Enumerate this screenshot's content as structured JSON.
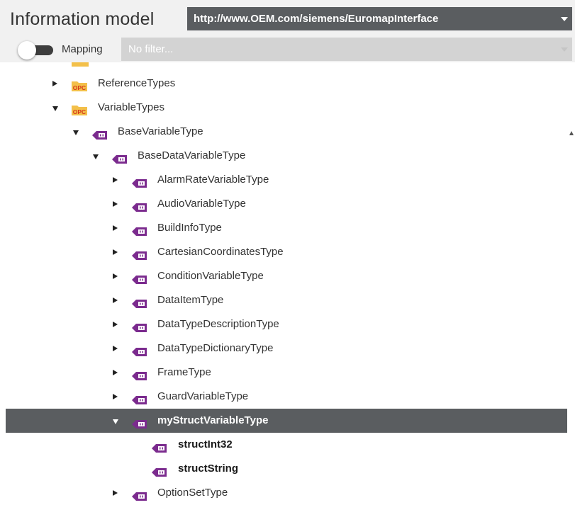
{
  "header": {
    "title": "Information model",
    "model_url": "http://www.OEM.com/siemens/EuromapInterface"
  },
  "filter": {
    "mapping_label": "Mapping",
    "placeholder": "No filter..."
  },
  "colors": {
    "selected_bg": "#5a5d60",
    "folder": "#f3c04a",
    "opc_text": "#d63a1a",
    "vartype_icon": "#7b2b8e"
  },
  "tree": [
    {
      "label": "ReferenceTypes",
      "icon": "opc-folder-icon",
      "expanded": false
    },
    {
      "label": "VariableTypes",
      "icon": "opc-folder-icon",
      "expanded": true
    },
    {
      "label": "BaseVariableType",
      "icon": "variable-type-icon",
      "expanded": true
    },
    {
      "label": "BaseDataVariableType",
      "icon": "variable-type-icon",
      "expanded": true
    },
    {
      "label": "AlarmRateVariableType",
      "icon": "variable-type-icon",
      "expanded": false
    },
    {
      "label": "AudioVariableType",
      "icon": "variable-type-icon",
      "expanded": false
    },
    {
      "label": "BuildInfoType",
      "icon": "variable-type-icon",
      "expanded": false
    },
    {
      "label": "CartesianCoordinatesType",
      "icon": "variable-type-icon",
      "expanded": false
    },
    {
      "label": "ConditionVariableType",
      "icon": "variable-type-icon",
      "expanded": false
    },
    {
      "label": "DataItemType",
      "icon": "variable-type-icon",
      "expanded": false
    },
    {
      "label": "DataTypeDescriptionType",
      "icon": "variable-type-icon",
      "expanded": false
    },
    {
      "label": "DataTypeDictionaryType",
      "icon": "variable-type-icon",
      "expanded": false
    },
    {
      "label": "FrameType",
      "icon": "variable-type-icon",
      "expanded": false
    },
    {
      "label": "GuardVariableType",
      "icon": "variable-type-icon",
      "expanded": false
    },
    {
      "label": "myStructVariableType",
      "icon": "variable-type-icon",
      "expanded": true,
      "selected": true
    },
    {
      "label": "structInt32",
      "icon": "variable-type-icon"
    },
    {
      "label": "structString",
      "icon": "variable-type-icon"
    },
    {
      "label": "OptionSetType",
      "icon": "variable-type-icon",
      "expanded": false
    }
  ],
  "opc_icon_text": "OPC"
}
